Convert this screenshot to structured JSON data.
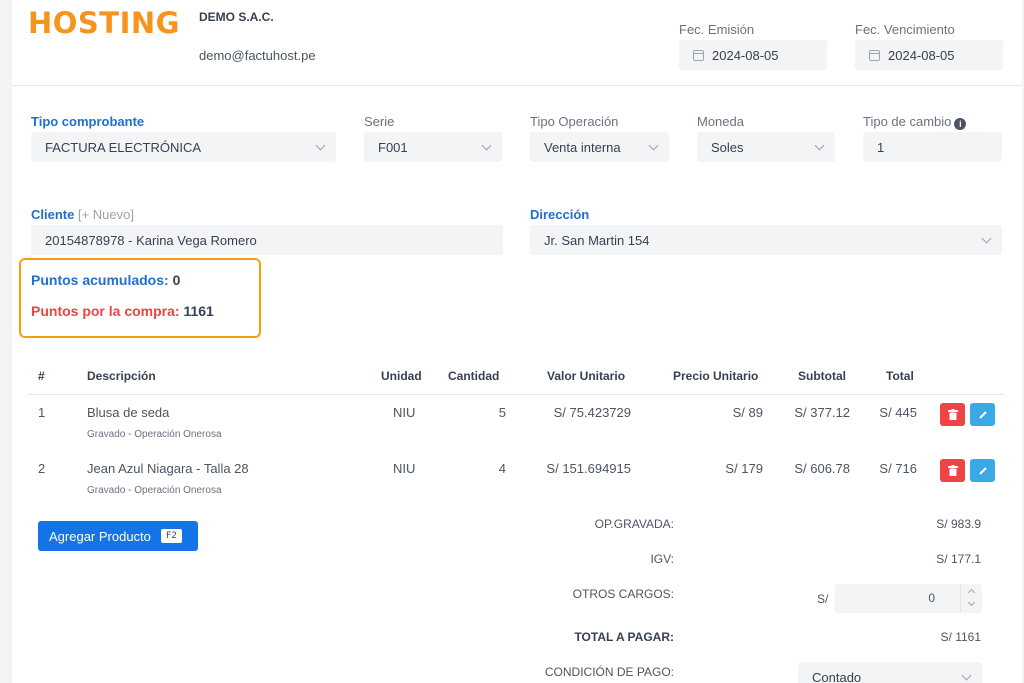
{
  "brand": {
    "logo": "HOSTING",
    "logo_color": "#f7941d",
    "company": "DEMO S.A.C.",
    "email": "demo@factuhost.pe"
  },
  "dates": {
    "emision_label": "Fec. Emisión",
    "emision_value": "2024-08-05",
    "vencimiento_label": "Fec. Vencimiento",
    "vencimiento_value": "2024-08-05"
  },
  "form": {
    "tipo_comprobante": {
      "label": "Tipo comprobante",
      "value": "FACTURA ELECTRÓNICA"
    },
    "serie": {
      "label": "Serie",
      "value": "F001"
    },
    "tipo_operacion": {
      "label": "Tipo Operación",
      "value": "Venta interna"
    },
    "moneda": {
      "label": "Moneda",
      "value": "Soles"
    },
    "tipo_cambio": {
      "label": "Tipo de cambio",
      "value": "1",
      "info_icon": "info-icon"
    },
    "cliente": {
      "label": "Cliente",
      "nuevo": "[+ Nuevo]",
      "value": "20154878978 - Karina Vega Romero"
    },
    "direccion": {
      "label": "Dirección",
      "value": "Jr. San Martin 154"
    }
  },
  "points": {
    "acumulados_label": "Puntos acumulados:",
    "acumulados_value": "0",
    "compra_label": "Puntos por la compra:",
    "compra_value": "1161",
    "box_color": "#f59e0b"
  },
  "table": {
    "headers": [
      "#",
      "Descripción",
      "Unidad",
      "Cantidad",
      "Valor Unitario",
      "Precio Unitario",
      "Subtotal",
      "Total"
    ],
    "rows": [
      {
        "num": "1",
        "desc": "Blusa de seda",
        "sub": "Gravado - Operación Onerosa",
        "unidad": "NIU",
        "cantidad": "5",
        "valor": "S/ 75.423729",
        "precio": "S/ 89",
        "subtotal": "S/ 377.12",
        "total": "S/ 445"
      },
      {
        "num": "2",
        "desc": "Jean Azul Niagara - Talla 28",
        "sub": "Gravado - Operación Onerosa",
        "unidad": "NIU",
        "cantidad": "4",
        "valor": "S/ 151.694915",
        "precio": "S/ 179",
        "subtotal": "S/ 606.78",
        "total": "S/ 716"
      }
    ]
  },
  "actions": {
    "add_product": "Agregar Producto",
    "add_shortcut": "F2"
  },
  "totals": {
    "gravada_label": "OP.GRAVADA:",
    "gravada_value": "S/ 983.9",
    "igv_label": "IGV:",
    "igv_value": "S/ 177.1",
    "otros_label": "OTROS CARGOS:",
    "otros_currency": "S/",
    "otros_value": "0",
    "total_label": "TOTAL A PAGAR:",
    "total_value": "S/ 1161",
    "condicion_label": "CONDICIÓN DE PAGO:",
    "condicion_value": "Contado"
  }
}
